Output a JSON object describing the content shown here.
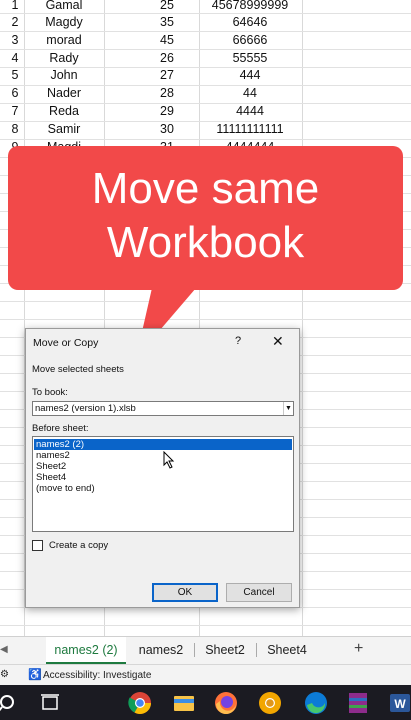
{
  "rows": [
    {
      "num": "1",
      "name": "Gamal",
      "age": "25",
      "phone": "45678999999"
    },
    {
      "num": "2",
      "name": "Magdy",
      "age": "35",
      "phone": "64646"
    },
    {
      "num": "3",
      "name": "morad",
      "age": "45",
      "phone": "66666"
    },
    {
      "num": "4",
      "name": "Rady",
      "age": "26",
      "phone": "55555"
    },
    {
      "num": "5",
      "name": "John",
      "age": "27",
      "phone": "444"
    },
    {
      "num": "6",
      "name": "Nader",
      "age": "28",
      "phone": "44"
    },
    {
      "num": "7",
      "name": "Reda",
      "age": "29",
      "phone": "4444"
    },
    {
      "num": "8",
      "name": "Samir",
      "age": "30",
      "phone": "11111111111"
    },
    {
      "num": "9",
      "name": "Magdi",
      "age": "31",
      "phone": "4444444"
    }
  ],
  "callout": {
    "line1": "Move same",
    "line2": "Workbook",
    "color": "#f24949"
  },
  "dialog": {
    "title": "Move or Copy",
    "help": "?",
    "close": "✕",
    "subtitle": "Move selected sheets",
    "to_book_label": "To book:",
    "to_book_value": "names2 (version 1).xlsb",
    "before_sheet_label": "Before sheet:",
    "sheets": [
      "names2 (2)",
      "names2",
      "Sheet2",
      "Sheet4",
      "(move to end)"
    ],
    "selected_index": 0,
    "create_copy_label": "Create a copy",
    "create_copy_checked": false,
    "ok_label": "OK",
    "cancel_label": "Cancel"
  },
  "tabs": {
    "left_arrow": "◀",
    "items": [
      "names2 (2)",
      "names2",
      "Sheet2",
      "Sheet4"
    ],
    "active": "names2 (2)",
    "add": "+"
  },
  "status": {
    "accessibility": "Accessibility: Investigate"
  },
  "taskbar": {
    "icons": [
      "search-icon",
      "task-view-icon",
      "chrome-icon",
      "file-explorer-icon",
      "firefox-icon",
      "chrome-canary-icon",
      "edge-icon",
      "winrar-icon",
      "word-icon"
    ]
  },
  "colors": {
    "excel_green": "#1e7a3f",
    "selection_blue": "#0a64c9",
    "taskbar": "#1b1b22"
  }
}
